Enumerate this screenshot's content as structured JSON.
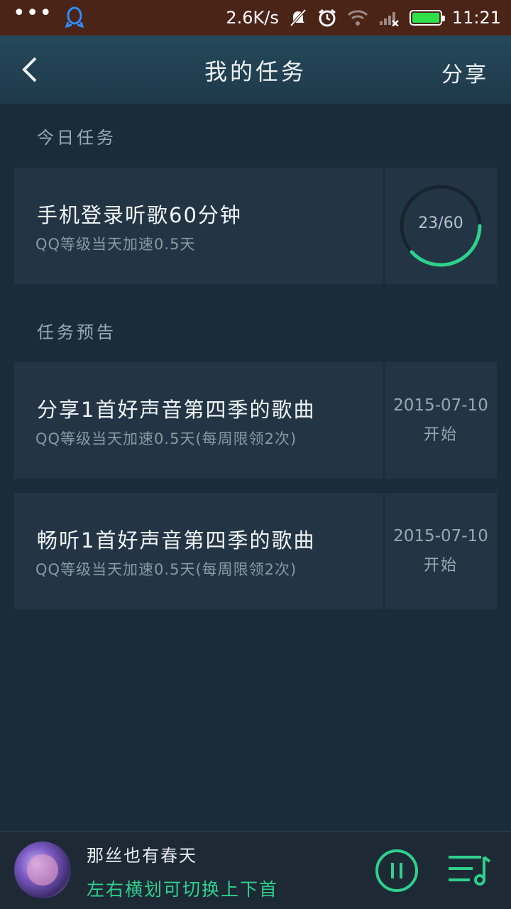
{
  "status_bar": {
    "dots": "•••",
    "speed": "2.6K/s",
    "time": "11:21",
    "battery_level": 1.0,
    "battery_color": "#2ee04a",
    "icons": [
      "qq-icon",
      "mute-icon",
      "alarm-icon",
      "wifi-icon",
      "signal-icon",
      "battery-icon"
    ]
  },
  "header": {
    "title": "我的任务",
    "share": "分享"
  },
  "today": {
    "label": "今日任务",
    "task": {
      "title": "手机登录听歌60分钟",
      "subtitle": "QQ等级当天加速0.5天",
      "progress_text": "23/60",
      "progress": 0.383
    }
  },
  "preview": {
    "label": "任务预告",
    "tasks": [
      {
        "title": "分享1首好声音第四季的歌曲",
        "subtitle": "QQ等级当天加速0.5天(每周限领2次)",
        "date": "2015-07-10",
        "start": "开始"
      },
      {
        "title": "畅听1首好声音第四季的歌曲",
        "subtitle": "QQ等级当天加速0.5天(每周限领2次)",
        "date": "2015-07-10",
        "start": "开始"
      }
    ]
  },
  "player": {
    "song": "那丝也有春天",
    "hint": "左右横划可切换上下首",
    "accent": "#2fd08c"
  }
}
